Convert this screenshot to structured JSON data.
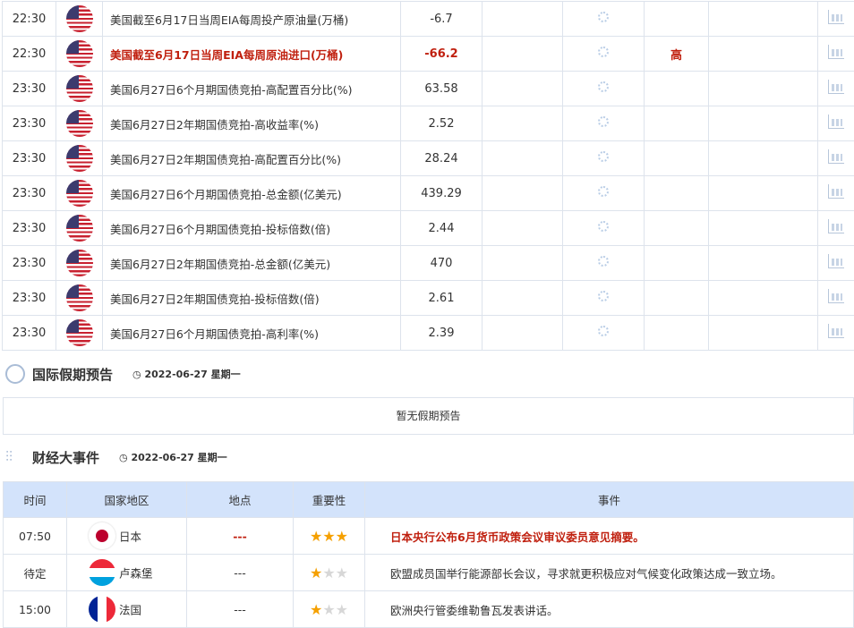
{
  "calendar_rows": [
    {
      "time": "22:30",
      "country": "us",
      "name": "美国截至6月17日当周EIA每周投产原油量(万桶)",
      "value": "-6.7",
      "importance": "",
      "highlight": false
    },
    {
      "time": "22:30",
      "country": "us",
      "name": "美国截至6月17日当周EIA每周原油进口(万桶)",
      "value": "-66.2",
      "importance": "高",
      "highlight": true
    },
    {
      "time": "23:30",
      "country": "us",
      "name": "美国6月27日6个月期国债竞拍-高配置百分比(%)",
      "value": "63.58",
      "importance": "",
      "highlight": false
    },
    {
      "time": "23:30",
      "country": "us",
      "name": "美国6月27日2年期国债竞拍-高收益率(%)",
      "value": "2.52",
      "importance": "",
      "highlight": false
    },
    {
      "time": "23:30",
      "country": "us",
      "name": "美国6月27日2年期国债竞拍-高配置百分比(%)",
      "value": "28.24",
      "importance": "",
      "highlight": false
    },
    {
      "time": "23:30",
      "country": "us",
      "name": "美国6月27日6个月期国债竞拍-总金额(亿美元)",
      "value": "439.29",
      "importance": "",
      "highlight": false
    },
    {
      "time": "23:30",
      "country": "us",
      "name": "美国6月27日6个月期国债竞拍-投标倍数(倍)",
      "value": "2.44",
      "importance": "",
      "highlight": false
    },
    {
      "time": "23:30",
      "country": "us",
      "name": "美国6月27日2年期国债竞拍-总金额(亿美元)",
      "value": "470",
      "importance": "",
      "highlight": false
    },
    {
      "time": "23:30",
      "country": "us",
      "name": "美国6月27日2年期国债竞拍-投标倍数(倍)",
      "value": "2.61",
      "importance": "",
      "highlight": false
    },
    {
      "time": "23:30",
      "country": "us",
      "name": "美国6月27日6个月期国债竞拍-高利率(%)",
      "value": "2.39",
      "importance": "",
      "highlight": false
    }
  ],
  "holiday": {
    "title": "国际假期预告",
    "date": "2022-06-27 星期一",
    "empty": "暂无假期预告"
  },
  "events": {
    "title": "财经大事件",
    "date": "2022-06-27 星期一",
    "headers": [
      "时间",
      "国家地区",
      "地点",
      "重要性",
      "事件"
    ],
    "rows": [
      {
        "time": "07:50",
        "flag": "jp",
        "country": "日本",
        "place": "---",
        "stars": 3,
        "event": "日本央行公布6月货币政策会议审议委员意见摘要。",
        "highlight": true
      },
      {
        "time": "待定",
        "flag": "lu",
        "country": "卢森堡",
        "place": "---",
        "stars": 1,
        "event": "欧盟成员国举行能源部长会议，寻求就更积极应对气候变化政策达成一致立场。",
        "highlight": false
      },
      {
        "time": "15:00",
        "flag": "fr",
        "country": "法国",
        "place": "---",
        "stars": 1,
        "event": "欧洲央行管委维勒鲁瓦发表讲话。",
        "highlight": false
      }
    ]
  }
}
